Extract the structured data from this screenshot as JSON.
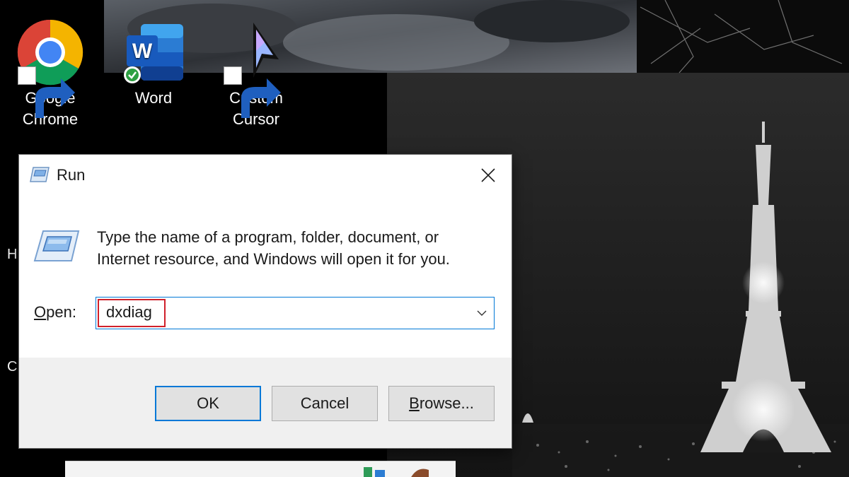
{
  "desktop": {
    "icons": [
      {
        "label": "Google Chrome",
        "icon": "chrome-icon",
        "shortcut": true
      },
      {
        "label": "Word",
        "icon": "word-icon",
        "shortcut": false
      },
      {
        "label": "Custom Cursor",
        "icon": "custom-cursor-icon",
        "shortcut": true
      }
    ],
    "edge_letters": [
      "H",
      "C"
    ]
  },
  "run_dialog": {
    "title": "Run",
    "instructions": "Type the name of a program, folder, document, or Internet resource, and Windows will open it for you.",
    "open_label_mnemonic": "O",
    "open_label_rest": "pen:",
    "open_value": "dxdiag",
    "buttons": {
      "ok": "OK",
      "cancel": "Cancel",
      "browse_mnemonic": "B",
      "browse_rest": "rowse..."
    },
    "colors": {
      "accent": "#0078d7",
      "highlight": "#d0202a",
      "footer": "#f0f0f0"
    }
  }
}
